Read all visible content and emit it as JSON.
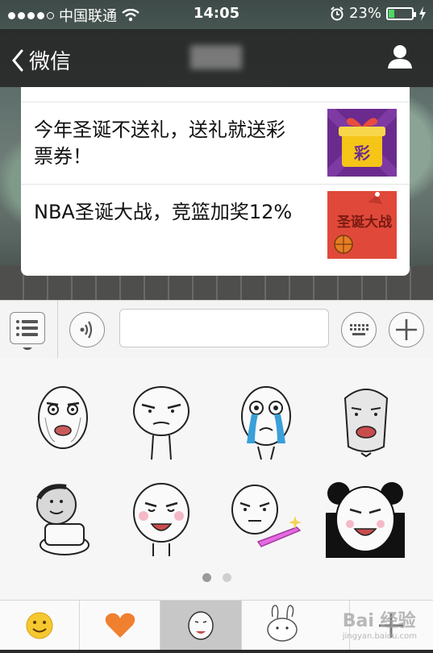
{
  "status_bar": {
    "carrier": "中国联通",
    "time": "14:05",
    "battery_text": "23%",
    "battery_level": 0.23
  },
  "nav": {
    "back_label": "微信"
  },
  "news": {
    "items": [
      {
        "text": "今年圣诞不送礼，送礼就送彩票券！",
        "thumb_label": "彩"
      },
      {
        "text": "NBA圣诞大战，竞篮加奖12%",
        "thumb_label": "圣诞大战"
      }
    ]
  },
  "stickers": {
    "rows": [
      [
        "meme-face-shocked",
        "meme-face-unimpressed",
        "meme-face-crying",
        "meme-face-surprised"
      ],
      [
        "meme-face-toilet",
        "meme-face-blush-laugh",
        "meme-face-knife",
        "panda-face-laugh"
      ]
    ],
    "page_count": 2,
    "current_page": 1
  },
  "tabs": [
    "emoji-smile-icon",
    "heart-icon",
    "meme-sticker-icon",
    "bunny-icon",
    "add-icon"
  ],
  "watermark": {
    "main": "Bai 经验",
    "sub": "jingyan.baidu.com"
  }
}
